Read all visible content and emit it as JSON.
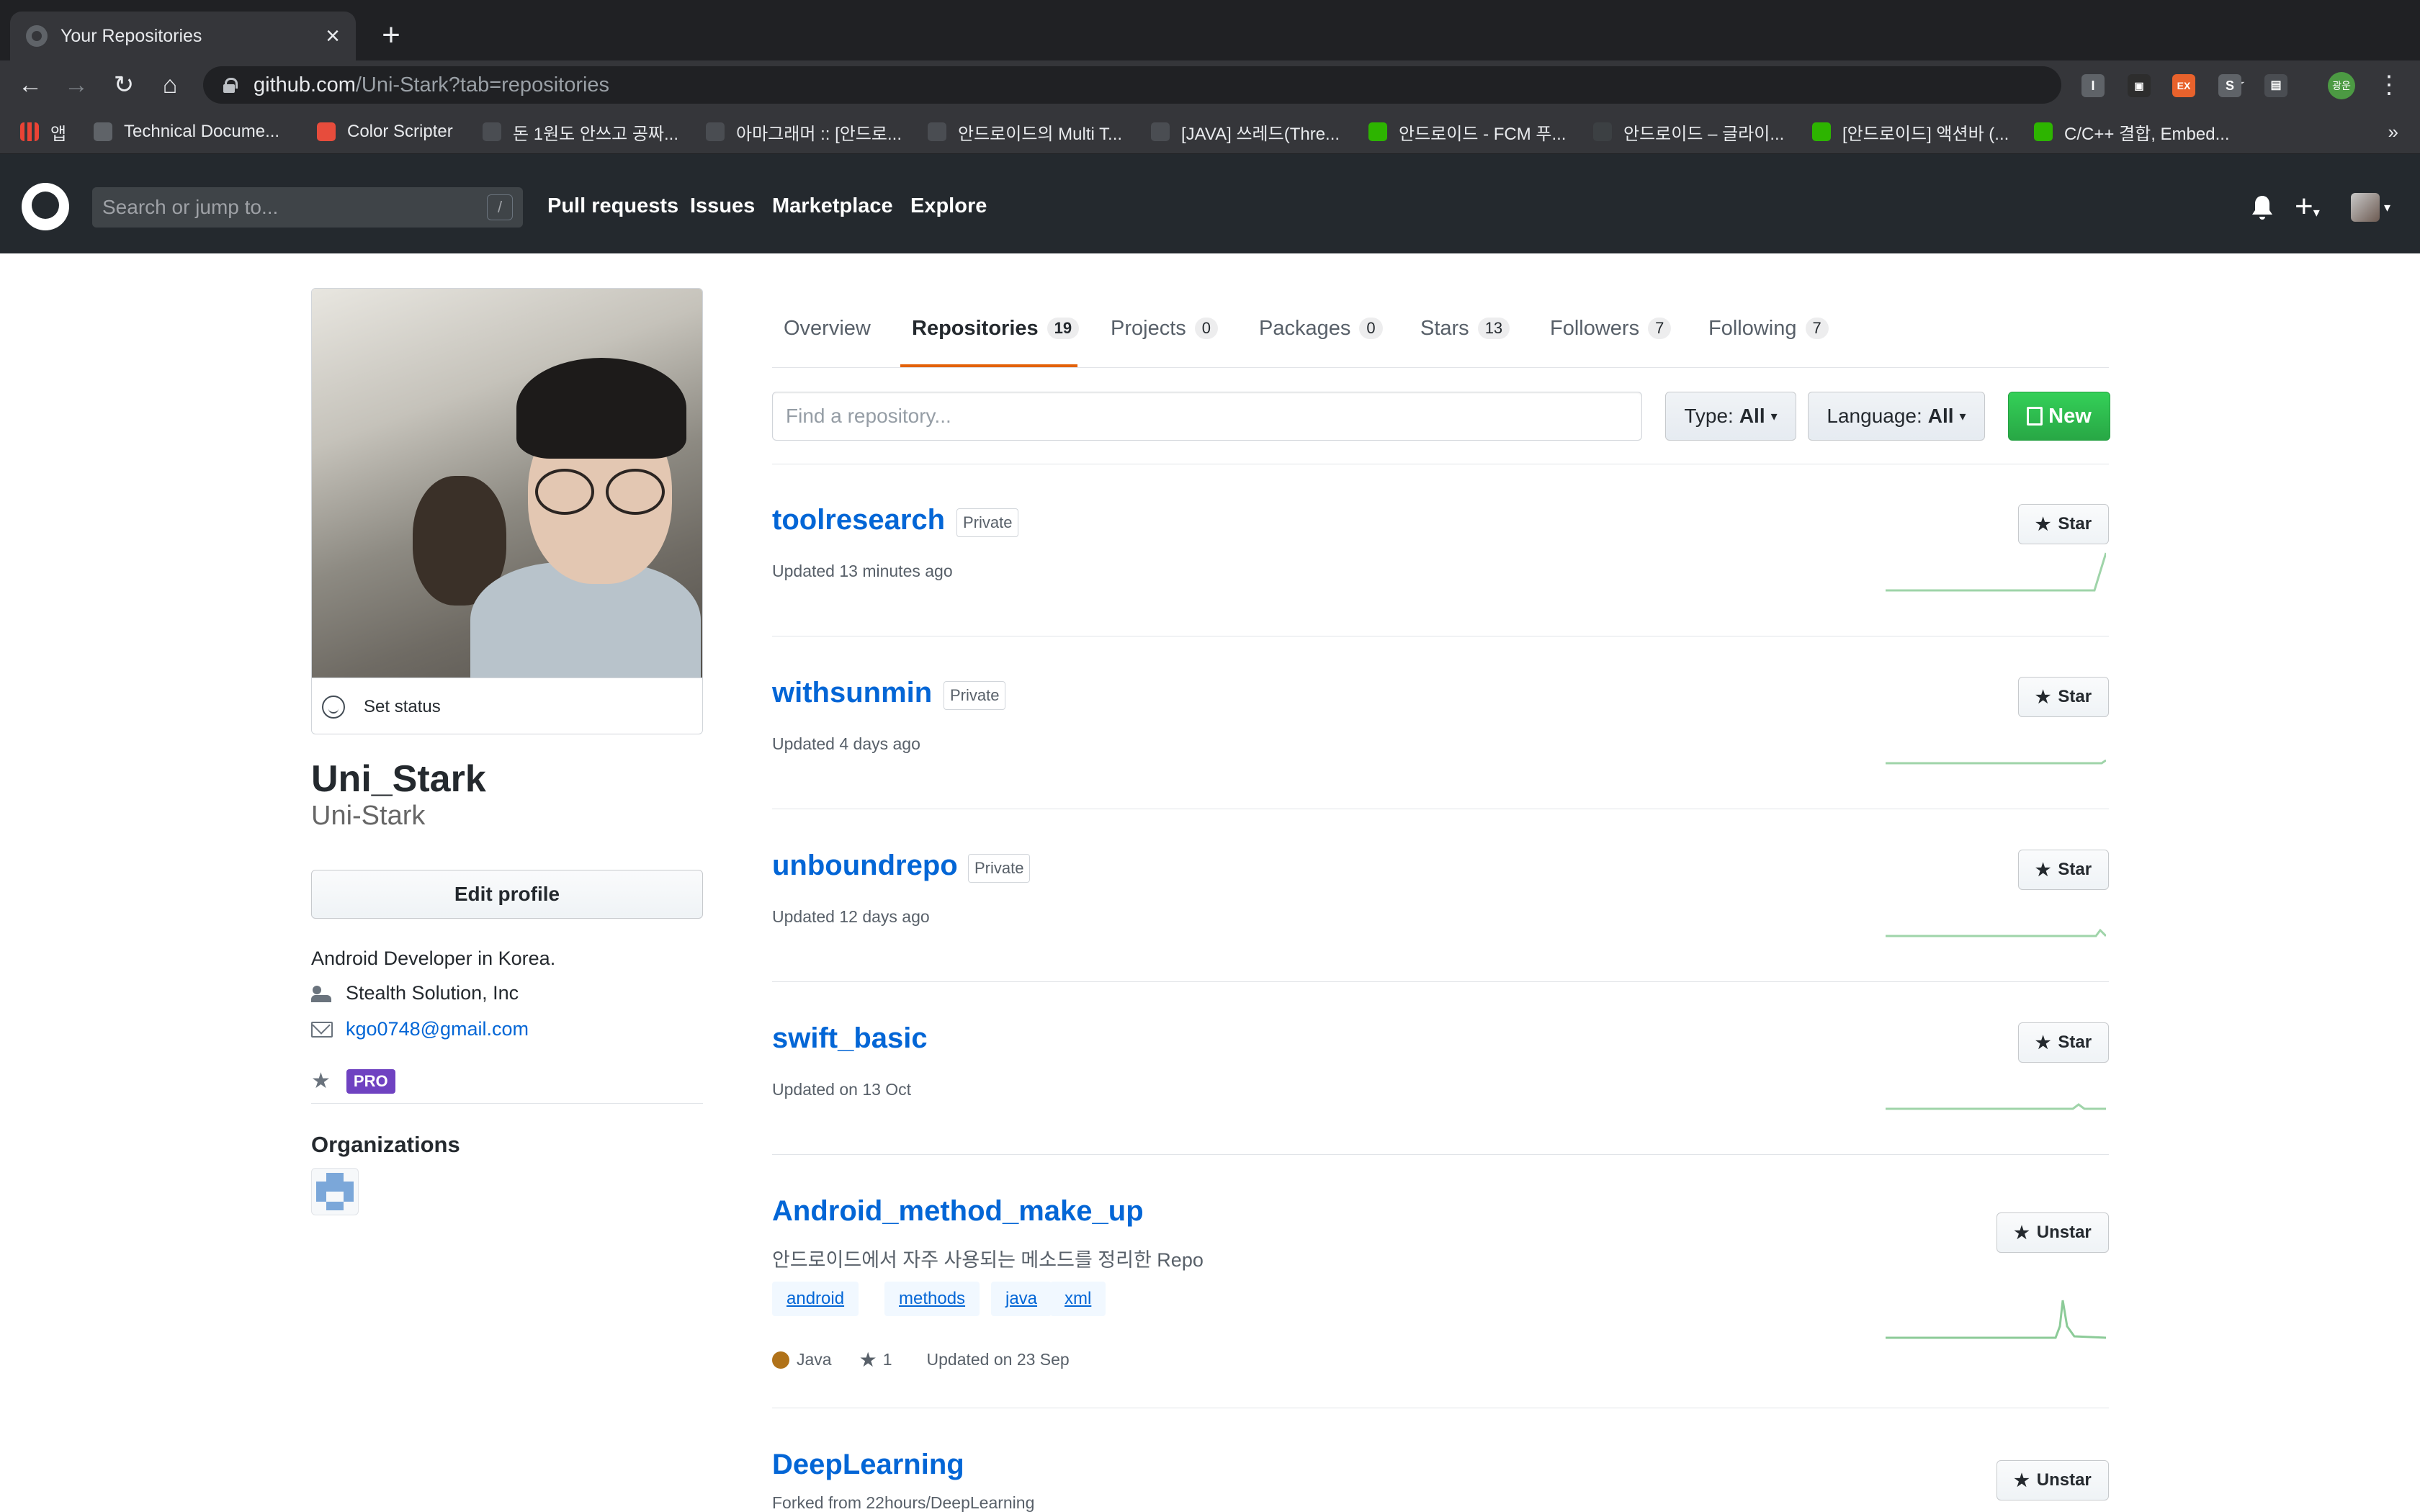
{
  "browser": {
    "tab_title": "Your Repositories",
    "url_host": "github.com",
    "url_path": "/Uni-Stark?tab=repositories",
    "bookmarks": [
      "앱",
      "Technical Docume...",
      "Color Scripter",
      "돈 1원도 안쓰고 공짜...",
      "아마그래머 :: [안드로...",
      "안드로이드의 Multi T...",
      "[JAVA] 쓰레드(Thre...",
      "안드로이드 - FCM 푸...",
      "안드로이드 – 글라이...",
      "[안드로이드] 액션바 (...",
      "C/C++ 결합, Embed..."
    ],
    "bookmarks_more": "»",
    "extension_labels": [
      "I",
      "▣",
      "EX",
      "S",
      "▤"
    ],
    "profile_initials": "광운"
  },
  "gh_header": {
    "search_placeholder": "Search or jump to...",
    "slash_key": "/",
    "nav": [
      "Pull requests",
      "Issues",
      "Marketplace",
      "Explore"
    ]
  },
  "profile": {
    "set_status": "Set status",
    "fullname": "Uni_Stark",
    "username": "Uni-Stark",
    "edit_profile": "Edit profile",
    "bio": "Android Developer in Korea.",
    "company": "Stealth Solution, Inc",
    "email": "kgo0748@gmail.com",
    "pro_badge": "PRO",
    "organizations_title": "Organizations"
  },
  "tabs": [
    {
      "label": "Overview",
      "count": null
    },
    {
      "label": "Repositories",
      "count": "19"
    },
    {
      "label": "Projects",
      "count": "0"
    },
    {
      "label": "Packages",
      "count": "0"
    },
    {
      "label": "Stars",
      "count": "13"
    },
    {
      "label": "Followers",
      "count": "7"
    },
    {
      "label": "Following",
      "count": "7"
    }
  ],
  "filters": {
    "find_placeholder": "Find a repository...",
    "type_label": "Type:",
    "type_value": "All",
    "language_label": "Language:",
    "language_value": "All",
    "new_label": "New"
  },
  "repos": [
    {
      "name": "toolresearch",
      "private_label": "Private",
      "updated": "Updated 13 minutes ago",
      "star_label": "Star"
    },
    {
      "name": "withsunmin",
      "private_label": "Private",
      "updated": "Updated 4 days ago",
      "star_label": "Star"
    },
    {
      "name": "unboundrepo",
      "private_label": "Private",
      "updated": "Updated 12 days ago",
      "star_label": "Star"
    },
    {
      "name": "swift_basic",
      "updated": "Updated on 13 Oct",
      "star_label": "Star"
    },
    {
      "name": "Android_method_make_up",
      "description": "안드로이드에서 자주 사용되는 메소드를 정리한 Repo",
      "topics": [
        "android",
        "methods",
        "java",
        "xml"
      ],
      "language": "Java",
      "language_color": "#b07219",
      "stars": "1",
      "updated": "Updated on 23 Sep",
      "star_label": "Unstar"
    },
    {
      "name": "DeepLearning",
      "forked_from": "Forked from 22hours/DeepLearning",
      "star_label": "Unstar"
    }
  ],
  "colors": {
    "header_bg": "#24292e",
    "link": "#0366d6",
    "tab_selected_underline": "#e36209",
    "new_button": "#28a745",
    "pro_badge": "#6f42c1",
    "sparkline": "#40a954"
  }
}
